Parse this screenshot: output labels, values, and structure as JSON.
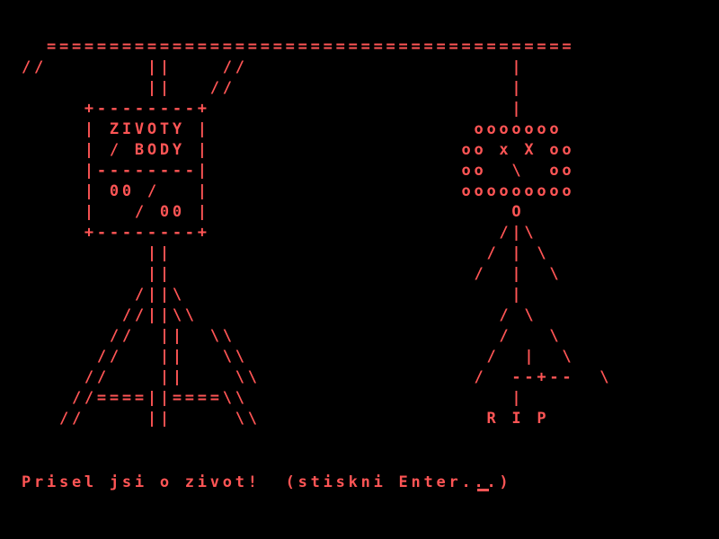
{
  "colors": {
    "background": "#000000",
    "foreground": "#FF5555"
  },
  "scene": {
    "gallows": [
      "  ==========================================",
      "//        ||    //                     |",
      "          ||   //                      |",
      "     +--------+                        |",
      "     | ZIVOTY |                     ooooooo",
      "     | / BODY |                    oo x X oo",
      "     |--------|                    oo  \\  oo",
      "     | 00 /   |                    ooooooooo",
      "     |   / 00 |                        O",
      "     +--------+                       /|\\",
      "          ||                         / | \\",
      "          ||                        /  |  \\",
      "         /||\\                          |",
      "        //||\\\\                        / \\",
      "       //  ||  \\\\                     /   \\",
      "      //   ||   \\\\                   /  |  \\",
      "     //    ||    \\\\                 /  --+--  \\",
      "    //====||====\\\\                     |",
      "   //     ||     \\\\                  R I P"
    ]
  },
  "status": {
    "message": "Prisel jsi o zivot!  (stiskni Enter...)"
  }
}
